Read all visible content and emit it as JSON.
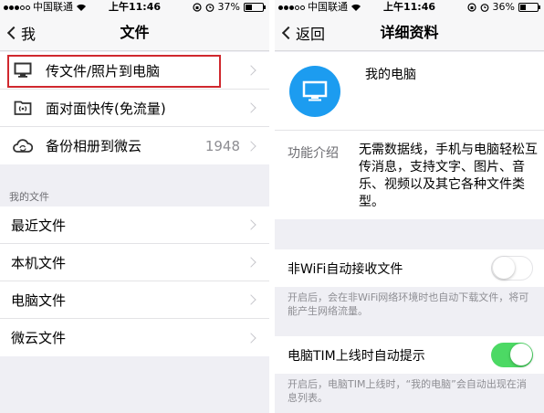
{
  "left": {
    "status": {
      "carrier": "中国联通",
      "time": "上午11:46",
      "battery": "37%",
      "battery_level": 0.37
    },
    "nav": {
      "back": "我",
      "title": "文件"
    },
    "top_rows": [
      {
        "label": "传文件/照片到电脑",
        "icon": "monitor-icon"
      },
      {
        "label": "面对面快传(免流量)",
        "icon": "face-to-face-icon"
      },
      {
        "label": "备份相册到微云",
        "icon": "cloud-sync-icon",
        "value": "1948"
      }
    ],
    "section_title": "我的文件",
    "file_rows": [
      {
        "label": "最近文件"
      },
      {
        "label": "本机文件"
      },
      {
        "label": "电脑文件"
      },
      {
        "label": "微云文件"
      }
    ]
  },
  "right": {
    "status": {
      "carrier": "中国联通",
      "time": "上午11:46",
      "battery": "36%",
      "battery_level": 0.36
    },
    "nav": {
      "back": "返回",
      "title": "详细资料"
    },
    "profile": {
      "name": "我的电脑"
    },
    "description": {
      "label": "功能介绍",
      "text": "无需数据线，手机与电脑轻松互传消息，支持文字、图片、音乐、视频以及其它各种文件类型。"
    },
    "toggles": [
      {
        "label": "非WiFi自动接收文件",
        "on": false,
        "hint": "开启后，会在非WiFi网络环境时也自动下载文件，将可能产生网络流量。"
      },
      {
        "label": "电脑TIM上线时自动提示",
        "on": true,
        "hint": "开启后，电脑TIM上线时，“我的电脑”会自动出现在消息列表。"
      }
    ]
  },
  "colors": {
    "accent": "#1c9cf0",
    "toggle_on": "#4cd964",
    "highlight": "#d0282e"
  }
}
